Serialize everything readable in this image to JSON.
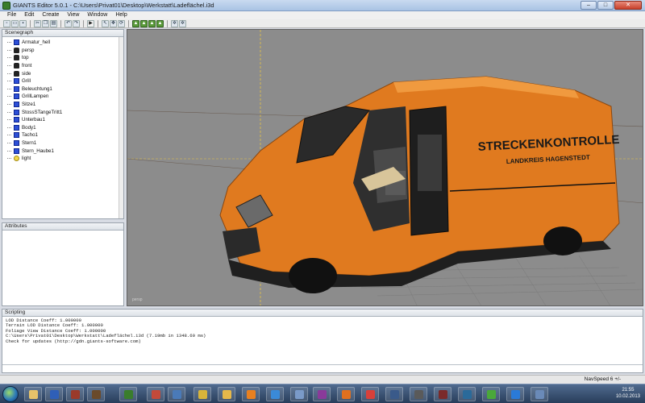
{
  "window": {
    "title": "GIANTS Editor 5.0.1 - C:\\Users\\Privat01\\Desktop\\Werkstatt\\Ladeflächel.i3d",
    "minimize": "–",
    "maximize": "□",
    "close": "✕"
  },
  "menu": [
    "File",
    "Edit",
    "Create",
    "View",
    "Window",
    "Help"
  ],
  "toolbar": {
    "icons": [
      "new-icon",
      "open-icon",
      "save-icon",
      "cut-icon",
      "copy-icon",
      "paste-icon",
      "undo-icon",
      "redo-icon",
      "play-icon",
      "select-icon",
      "move-icon",
      "rotate-icon",
      "scale-icon",
      "terrain-icon",
      "paint-icon"
    ]
  },
  "scenegraph": {
    "title": "Scenegraph",
    "nodes": [
      {
        "label": "Armatur_hell",
        "icon": "shape"
      },
      {
        "label": "persp",
        "icon": "camera"
      },
      {
        "label": "top",
        "icon": "camera"
      },
      {
        "label": "front",
        "icon": "camera"
      },
      {
        "label": "side",
        "icon": "camera"
      },
      {
        "label": "Grill",
        "icon": "shape"
      },
      {
        "label": "Beleuchtung1",
        "icon": "shape"
      },
      {
        "label": "GrillLampen",
        "icon": "shape"
      },
      {
        "label": "Sitze1",
        "icon": "shape"
      },
      {
        "label": "StossSTangeTritt1",
        "icon": "shape"
      },
      {
        "label": "Unterbau1",
        "icon": "shape"
      },
      {
        "label": "Body1",
        "icon": "shape"
      },
      {
        "label": "Tacho1",
        "icon": "shape"
      },
      {
        "label": "Stern1",
        "icon": "shape"
      },
      {
        "label": "Stern_Haube1",
        "icon": "shape"
      },
      {
        "label": "light",
        "icon": "light"
      }
    ]
  },
  "attributes": {
    "title": "Attributes"
  },
  "viewport": {
    "camera_label": "persp",
    "van_text_line1": "STRECKENKONTROLLE",
    "van_text_line2": "LANDKREIS HAGENSTEDT",
    "van_color": "#e07a1f"
  },
  "scripting": {
    "title": "Scripting",
    "lines": [
      "  LOD Distance Coeff: 1.000000",
      "  Terrain LOD Distance Coeff: 1.000000",
      "  Foliage View Distance Coeff: 1.000000",
      "C:\\Users\\Privat01\\Desktop\\Werkstatt\\Ladeflächel.i3d (7.19mb in 1348.60 ms)",
      "Check for updates (http://gdn.giants-software.com)"
    ]
  },
  "status": {
    "navspeed": "NavSpeed 6 +/-"
  },
  "taskbar": {
    "time": "21:55",
    "date": "10.02.2013",
    "apps": [
      "explorer",
      "word",
      "game",
      "jigsaw",
      "paint",
      "editor",
      "folder",
      "vlc",
      "ie",
      "mail",
      "winrar",
      "firefox",
      "chrome",
      "media",
      "trash"
    ]
  }
}
